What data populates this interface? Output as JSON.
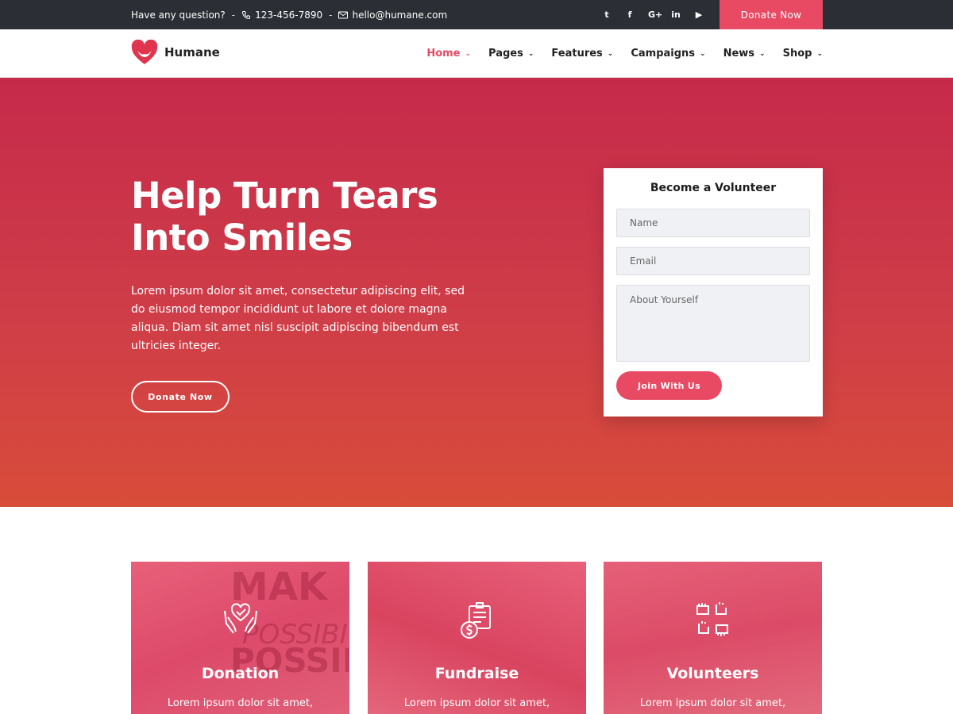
{
  "topbar": {
    "question": "Have any question?",
    "phone": "123-456-7890",
    "email": "hello@humane.com",
    "social_icons": [
      "twitter-icon",
      "facebook-icon",
      "google-plus-icon",
      "linkedin-icon",
      "youtube-icon"
    ],
    "social_glyphs": [
      "t",
      "f",
      "G+",
      "in",
      "▶"
    ],
    "donate_label": "Donate Now"
  },
  "header": {
    "brand": "Humane",
    "nav": [
      {
        "label": "Home",
        "active": true
      },
      {
        "label": "Pages",
        "active": false
      },
      {
        "label": "Features",
        "active": false
      },
      {
        "label": "Campaigns",
        "active": false
      },
      {
        "label": "News",
        "active": false
      },
      {
        "label": "Shop",
        "active": false
      }
    ]
  },
  "hero": {
    "title": "Help Turn Tears Into Smiles",
    "lead": "Lorem ipsum dolor sit amet, consectetur adipiscing elit, sed do eiusmod tempor incididunt ut labore et dolore magna aliqua. Diam sit amet nisl suscipit adipiscing bibendum est ultricies integer.",
    "donate_label": "Donate Now"
  },
  "volunteer_form": {
    "title": "Become a Volunteer",
    "name_placeholder": "Name",
    "email_placeholder": "Email",
    "about_placeholder": "About Yourself",
    "submit_label": "Join With Us"
  },
  "cards": [
    {
      "title": "Donation",
      "desc": "Lorem ipsum dolor sit amet,",
      "icon": "heart-hands-icon"
    },
    {
      "title": "Fundraise",
      "desc": "Lorem ipsum dolor sit amet,",
      "icon": "fundraise-icon"
    },
    {
      "title": "Volunteers",
      "desc": "Lorem ipsum dolor sit amet,",
      "icon": "volunteer-hands-icon"
    }
  ],
  "card_watermark": [
    "MAK",
    "POSSIBI",
    "POSSIBI"
  ],
  "colors": {
    "accent": "#e84a64",
    "topbar": "#2b2e35",
    "hero_top": "#c62a4a",
    "hero_bottom": "#d84c3a"
  }
}
